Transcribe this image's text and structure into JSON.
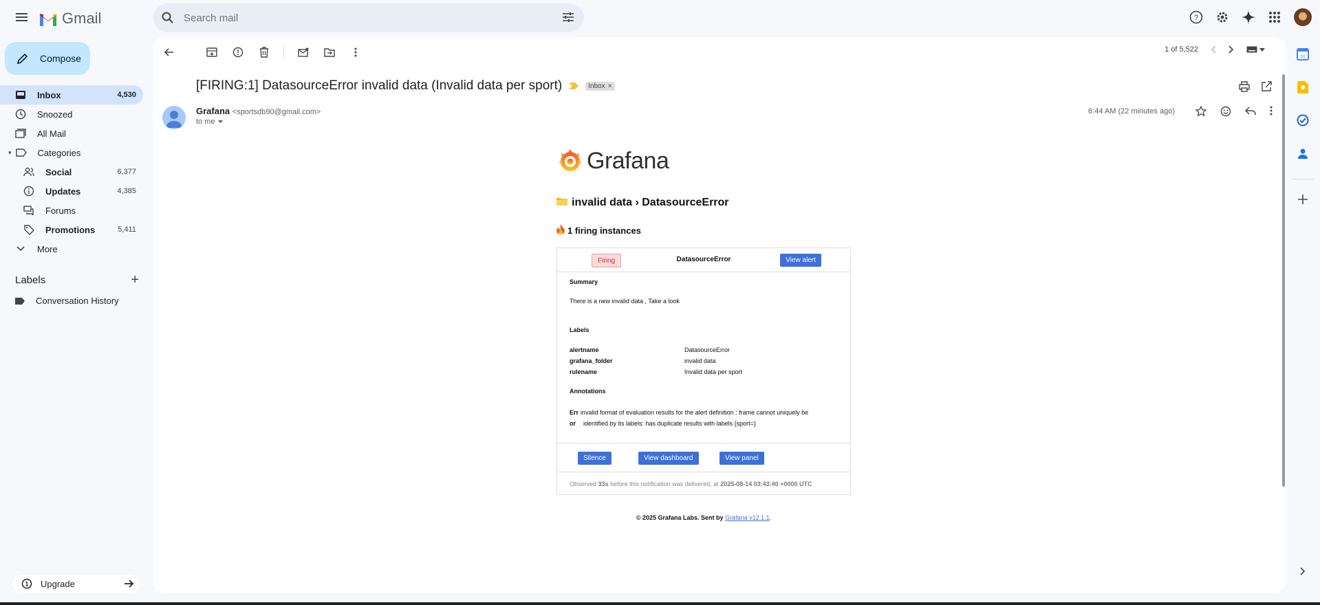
{
  "app": {
    "name": "Gmail",
    "search_placeholder": "Search mail"
  },
  "compose_label": "Compose",
  "nav": {
    "items": [
      {
        "label": "Inbox",
        "count": "4,530"
      },
      {
        "label": "Snoozed",
        "count": ""
      },
      {
        "label": "All Mail",
        "count": ""
      },
      {
        "label": "Categories",
        "count": ""
      },
      {
        "label": "Social",
        "count": "6,377"
      },
      {
        "label": "Updates",
        "count": "4,385"
      },
      {
        "label": "Forums",
        "count": ""
      },
      {
        "label": "Promotions",
        "count": "5,411"
      },
      {
        "label": "More",
        "count": ""
      }
    ],
    "labels_heading": "Labels",
    "user_labels": [
      "Conversation History"
    ],
    "upgrade_label": "Upgrade"
  },
  "toolbar": {
    "pager_text": "1 of 5,522"
  },
  "message": {
    "subject": "[FIRING:1] DatasourceError invalid data (Invalid data per sport)",
    "inbox_chip": "Inbox",
    "sender_name": "Grafana",
    "sender_email": "<sportsdb90@gmail.com>",
    "to": "to me",
    "time": "6:44 AM (22 minutes ago)"
  },
  "email_body": {
    "logo_text": "Grafana",
    "path": "invalid data › DatasourceError",
    "firing_count": "1 firing instances",
    "status_badge": "Firing",
    "alert_name": "DatasourceError",
    "view_alert": "View alert",
    "summary_title": "Summary",
    "summary_text": "There is a new invalid data , Take a look",
    "labels_title": "Labels",
    "labels": [
      {
        "key": "alertname",
        "value": "DatasourceError"
      },
      {
        "key": "grafana_folder",
        "value": "invalid data"
      },
      {
        "key": "rulename",
        "value": "Invalid data per sport"
      }
    ],
    "annotations_title": "Annotations",
    "annotation_key": "Err or",
    "annotation_key_line1": "Err",
    "annotation_key_line2": "or",
    "annotation_value_line1": "invalid format of evaluation results for the alert definition : frame cannot uniquely be",
    "annotation_value_line2": "identified by its labels: has duplicate results with labels {sport=}",
    "buttons": [
      "Silence",
      "View dashboard",
      "View panel"
    ],
    "footer_prefix": "Observed",
    "footer_observed": "33s",
    "footer_middle": "before this notification was delivered, at",
    "footer_timestamp": "2025-08-14 03:43:40 +0000 UTC",
    "copyright_prefix": "© 2025 Grafana Labs. Sent by",
    "copyright_link": "Grafana v12.1.1",
    "copyright_suffix": "."
  },
  "colors": {
    "accent": "#3d71d9",
    "compose_bg": "#c2e7ff",
    "active_nav": "#d3e3fd",
    "firing_bg": "#fbdada"
  }
}
